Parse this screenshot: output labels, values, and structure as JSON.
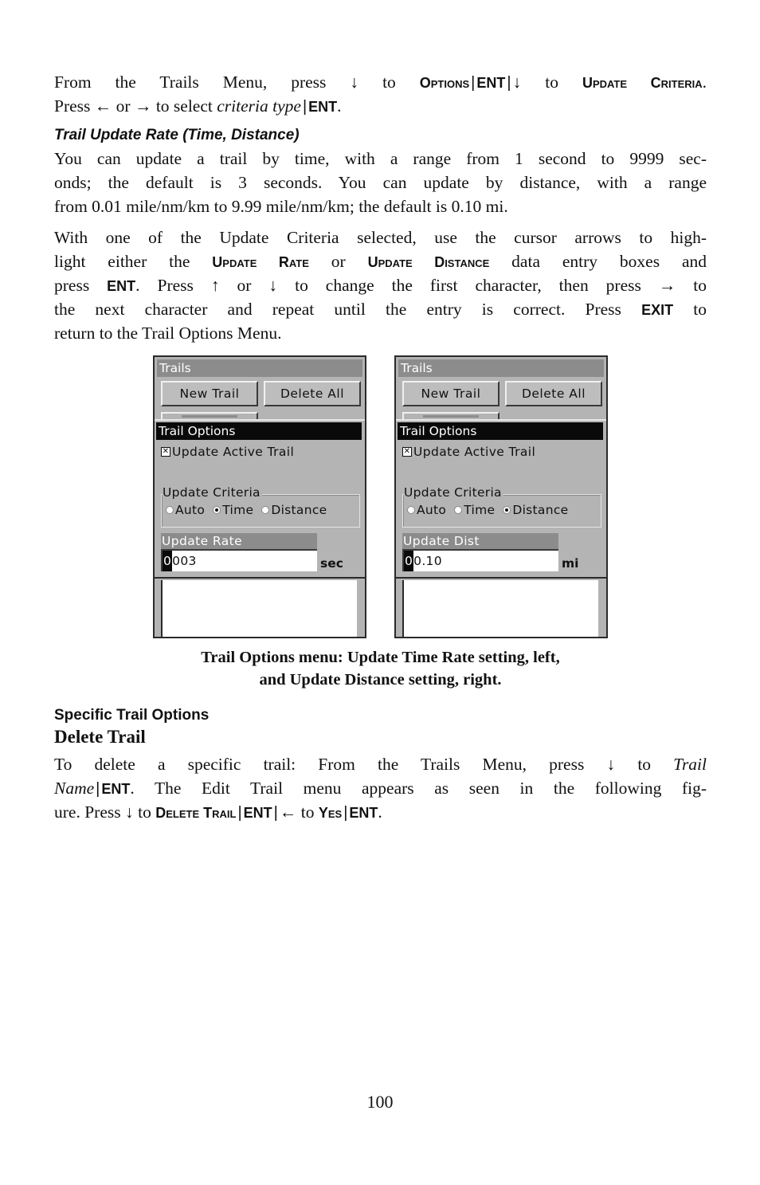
{
  "intro": {
    "lines": [
      [
        "From the Trails Menu, press ",
        {
          "arrow": "↓"
        },
        " to ",
        {
          "sc": "Options"
        },
        {
          "sep": "|"
        },
        {
          "k": "ENT"
        },
        {
          "sep": "|"
        },
        {
          "arrow": "↓"
        },
        " to ",
        {
          "sc": "Update Criteria"
        },
        "."
      ],
      [
        "Press ",
        {
          "arrow": "←"
        },
        " or ",
        {
          "arrow": "→"
        },
        " to select ",
        {
          "i": "criteria type"
        },
        {
          "sep": "|"
        },
        {
          "k": "ENT"
        },
        "."
      ]
    ]
  },
  "section_rate": {
    "heading": "Trail Update Rate (Time, Distance)",
    "para1": [
      "You can update a trail by time, with a range from 1 second to 9999 sec-",
      "onds; the default is 3 seconds. You can update by distance, with a range",
      "from 0.01 mile/nm/km to 9.99 mile/nm/km; the default is 0.10 mi."
    ],
    "para2": [
      [
        "With one of the Update Criteria selected, use the cursor arrows to high-"
      ],
      [
        "light either the ",
        {
          "sc": "Update Rate"
        },
        " or ",
        {
          "sc": "Update Distance"
        },
        " data entry boxes and"
      ],
      [
        "press ",
        {
          "k": "ENT"
        },
        ". Press ",
        {
          "arrow": "↑"
        },
        " or ",
        {
          "arrow": "↓"
        },
        " to change the first character, then press ",
        {
          "arrow": "→"
        },
        " to"
      ],
      [
        "the next character and repeat until the entry is correct. Press ",
        {
          "k": "EXIT"
        },
        " to"
      ],
      [
        "return to the Trail Options Menu."
      ]
    ]
  },
  "screens": [
    {
      "title": "Trails",
      "buttons": [
        "New Trail",
        "Delete All"
      ],
      "dialog_title": "Trail Options",
      "checkbox": {
        "label": "Update Active Trail",
        "checked": true,
        "mark": "✕"
      },
      "group_label": "Update Criteria",
      "radios": [
        {
          "label": "Auto",
          "selected": false
        },
        {
          "label": "Time",
          "selected": true
        },
        {
          "label": "Distance",
          "selected": false
        }
      ],
      "field_label": "Update Rate",
      "field_cursor_char": "0",
      "field_rest": "003",
      "unit": "sec"
    },
    {
      "title": "Trails",
      "buttons": [
        "New Trail",
        "Delete All"
      ],
      "dialog_title": "Trail Options",
      "checkbox": {
        "label": "Update Active Trail",
        "checked": true,
        "mark": "✕"
      },
      "group_label": "Update Criteria",
      "radios": [
        {
          "label": "Auto",
          "selected": false
        },
        {
          "label": "Time",
          "selected": false
        },
        {
          "label": "Distance",
          "selected": true
        }
      ],
      "field_label": "Update Dist",
      "field_cursor_char": "0",
      "field_rest": "0.10",
      "unit": "mi"
    }
  ],
  "caption": {
    "line1": "Trail Options menu: Update Time Rate setting, left,",
    "line2": "and Update Distance setting, right."
  },
  "section_specific": {
    "heading": "Specific Trail Options",
    "subheading": "Delete Trail",
    "para": [
      [
        "To delete a specific trail: From the Trails Menu, press ",
        {
          "arrow": "↓"
        },
        " to ",
        {
          "i": "Trail"
        }
      ],
      [
        {
          "i": "Name"
        },
        {
          "sep": "|"
        },
        {
          "k": "ENT"
        },
        ". The Edit Trail menu appears as seen in the following fig-"
      ],
      [
        "ure. Press ",
        {
          "arrow": "↓"
        },
        " to ",
        {
          "sc": "Delete Trail"
        },
        {
          "sep": "|"
        },
        {
          "k": "ENT"
        },
        {
          "sep": "|"
        },
        {
          "arrow": "←"
        },
        " to ",
        {
          "sc": "Yes"
        },
        {
          "sep": "|"
        },
        {
          "k": "ENT"
        },
        "."
      ]
    ]
  },
  "page_number": "100"
}
